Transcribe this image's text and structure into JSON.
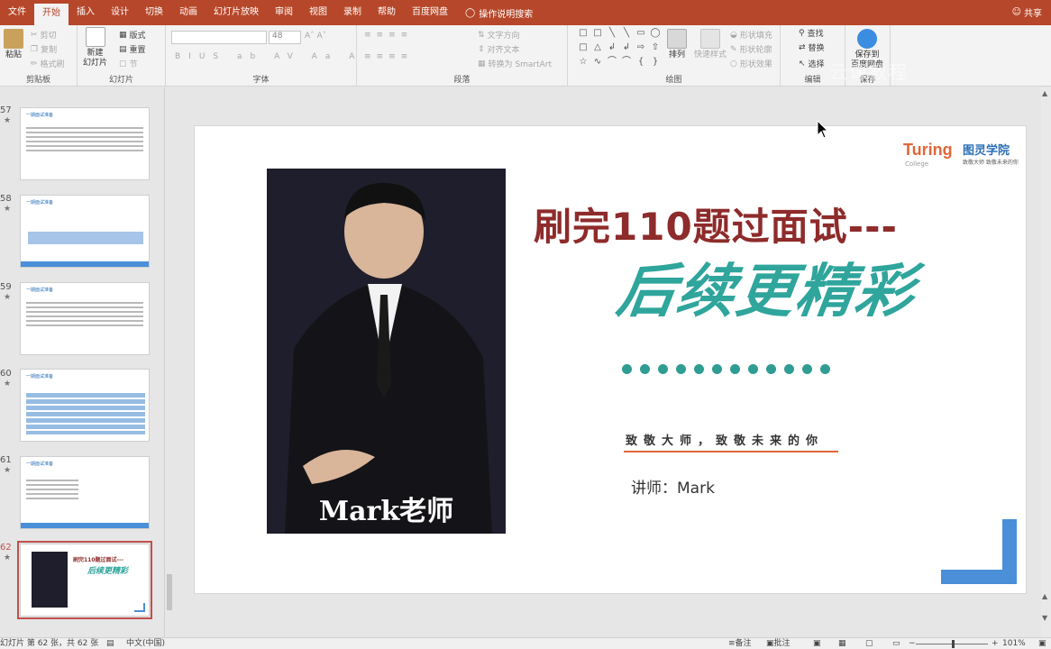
{
  "tabs": [
    {
      "label": "文件"
    },
    {
      "label": "开始"
    },
    {
      "label": "插入"
    },
    {
      "label": "设计"
    },
    {
      "label": "切换"
    },
    {
      "label": "动画"
    },
    {
      "label": "幻灯片放映"
    },
    {
      "label": "审阅"
    },
    {
      "label": "视图"
    },
    {
      "label": "录制"
    },
    {
      "label": "帮助"
    },
    {
      "label": "百度网盘"
    }
  ],
  "tell_me": "操作说明搜索",
  "share": "共享",
  "ribbon": {
    "clipboard": {
      "paste": "粘贴",
      "cut": "剪切",
      "copy": "复制",
      "format_painter": "格式刷",
      "label": "剪贴板"
    },
    "slides": {
      "new_slide": "新建\n幻灯片",
      "layout": "版式",
      "reset": "重置",
      "section": "节",
      "label": "幻灯片"
    },
    "font": {
      "size": "48",
      "label": "字体"
    },
    "paragraph": {
      "text_direction": "文字方向",
      "align_text": "对齐文本",
      "smartart": "转换为 SmartArt",
      "label": "段落"
    },
    "drawing": {
      "arrange": "排列",
      "quick_styles": "快速样式",
      "shape_fill": "形状填充",
      "shape_outline": "形状轮廓",
      "shape_effects": "形状效果",
      "label": "绘图"
    },
    "editing": {
      "find": "查找",
      "replace": "替换",
      "select": "选择",
      "label": "编辑"
    },
    "save": {
      "save_to_baidu": "保存到\n百度网盘",
      "label": "保存"
    }
  },
  "watermark": "云课教程",
  "thumbnails": [
    {
      "number": "57",
      "title": "一期面试准备"
    },
    {
      "number": "58",
      "title": "一期面试准备"
    },
    {
      "number": "59",
      "title": "一期面试准备"
    },
    {
      "number": "60",
      "title": "一期面试准备"
    },
    {
      "number": "61",
      "title": "一期面试准备"
    },
    {
      "number": "62",
      "title": "刷完110题过面试---"
    }
  ],
  "slide": {
    "photo_caption": "Mark老师",
    "headline1": "刷完110题过面试---",
    "headline2": "后续更精彩",
    "motto": "致敬大师，致敬未来的你",
    "lecturer": "讲师：Mark",
    "logo": {
      "brand": "Turing",
      "college": "College",
      "name_cn": "图灵学院",
      "tagline": "致敬大师 致敬未来的你"
    },
    "dots_count": 12
  },
  "status": {
    "slide_info": "幻灯片 第 62 张，共 62 张",
    "language": "中文(中国)",
    "notes": "备注",
    "comments": "批注",
    "zoom": "101%"
  },
  "colors": {
    "ribbon_accent": "#b7472a",
    "headline1": "#8e2b2b",
    "headline2": "#2fa59c",
    "motto_line": "#e0663a",
    "corner": "#4a8fd8"
  }
}
